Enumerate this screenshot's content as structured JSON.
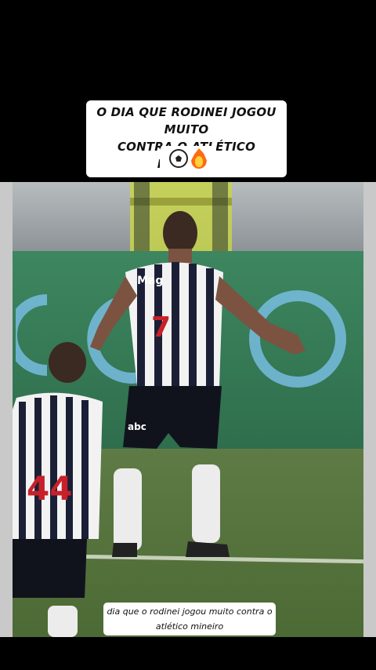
{
  "overlay": {
    "title_lines": [
      "O DIA QUE RODINEI JOGOU MUITO",
      "CONTRA O ATLÉTICO MINEIRO"
    ],
    "emojis": [
      "soccer-ball-icon",
      "fire-icon"
    ]
  },
  "video": {
    "jersey_number_main": "7",
    "jersey_number_kid": "44",
    "sponsor_chest": "Mag",
    "sponsor_shorts": "abc"
  },
  "caption": {
    "lines": [
      "dia que o rodinei jogou muito contra o",
      "atlético mineiro"
    ]
  },
  "colors": {
    "background": "#000000",
    "caption_bg": "#ffffff",
    "pitch": "#5a7640",
    "ad_board": "#3a8059"
  }
}
